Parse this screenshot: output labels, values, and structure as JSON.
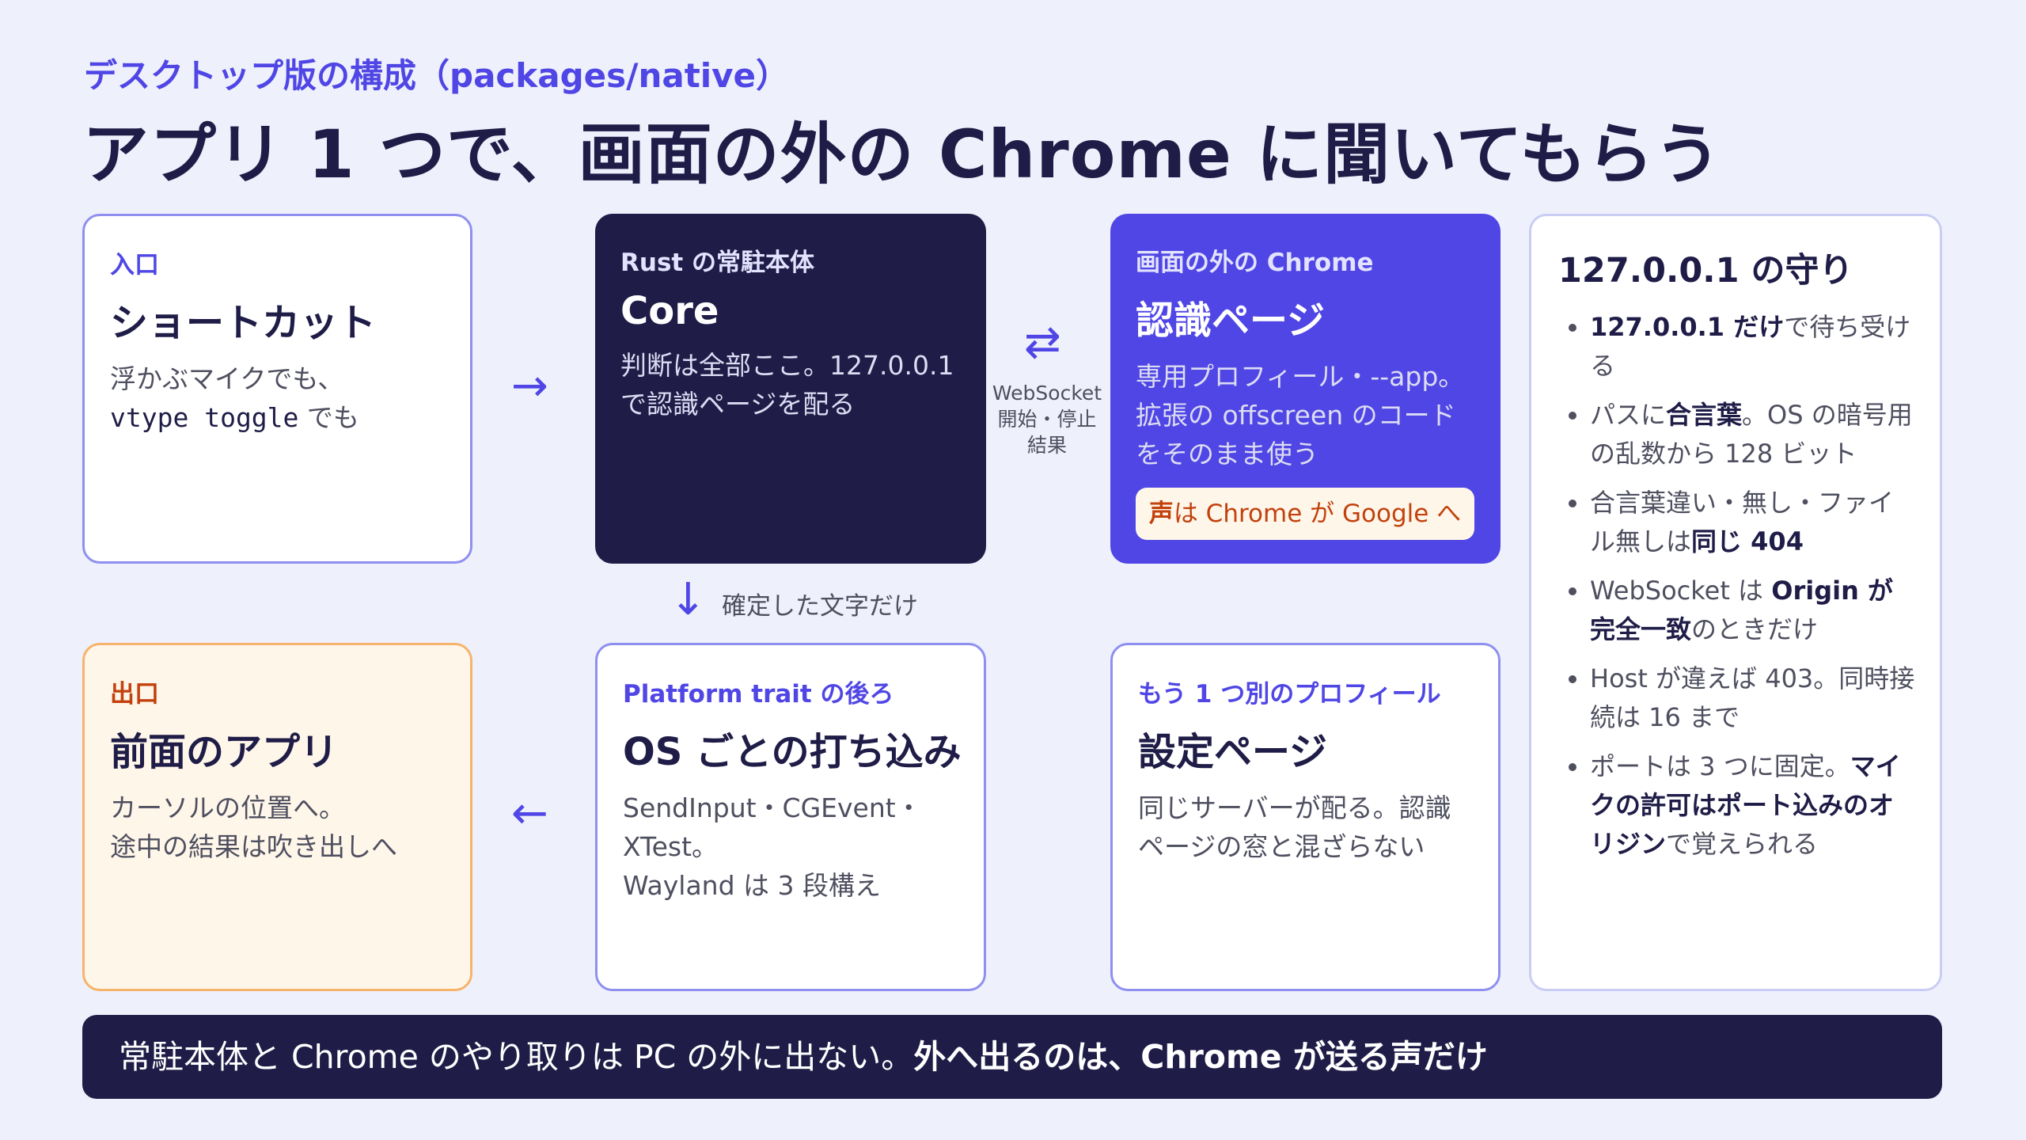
{
  "header": {
    "eyebrow": "デスクトップ版の構成（packages/native）",
    "title": "アプリ 1 つで、画面の外の Chrome に聞いてもらう"
  },
  "boxes": {
    "entry": {
      "kicker": "入口",
      "head": "ショートカット",
      "desc_line1": "浮かぶマイクでも、",
      "desc_mono": "vtype toggle",
      "desc_line2_suffix": " でも"
    },
    "core": {
      "kicker": "Rust の常駐本体",
      "head": "Core",
      "desc": "判断は全部ここ。127.0.0.1 で認識ページを配る"
    },
    "recognition": {
      "kicker": "画面の外の Chrome",
      "head": "認識ページ",
      "desc": "専用プロフィール・--app。拡張の offscreen のコードをそのまま使う",
      "pill_bold": "声",
      "pill_rest": "は Chrome が Google へ"
    },
    "exit": {
      "kicker": "出口",
      "head": "前面のアプリ",
      "desc_line1": "カーソルの位置へ。",
      "desc_line2": "途中の結果は吹き出しへ"
    },
    "platform": {
      "kicker": "Platform trait の後ろ",
      "head": "OS ごとの打ち込み",
      "desc_line1": "SendInput・CGEvent・XTest。",
      "desc_line2": "Wayland は 3 段構え"
    },
    "settings": {
      "kicker": "もう 1 つ別のプロフィール",
      "head": "設定ページ",
      "desc": "同じサーバーが配る。認識ページの窓と混ざらない"
    }
  },
  "arrows": {
    "right": "→",
    "left": "←",
    "down": "↓",
    "bidir": "⇄",
    "ws_line1": "WebSocket",
    "ws_line2": "開始・停止",
    "ws_line3": "結果",
    "down_label": "確定した文字だけ"
  },
  "guard": {
    "title": "127.0.0.1 の守り",
    "items": [
      {
        "bold": "127.0.0.1 だけ",
        "text": "で待ち受ける"
      },
      {
        "pre": "パスに",
        "bold": "合言葉",
        "text": "。OS の暗号用の乱数から 128 ビット"
      },
      {
        "pre": "合言葉違い・無し・ファイル無しは",
        "bold": "同じ 404",
        "text": ""
      },
      {
        "pre": "WebSocket は ",
        "bold": "Origin が完全一致",
        "text": "のときだけ"
      },
      {
        "pre": "Host が違えば 403。同時接続は 16 まで",
        "bold": "",
        "text": ""
      },
      {
        "pre": "ポートは 3 つに固定。",
        "bold": "マイクの許可はポート込みのオリジン",
        "text": "で覚えられる"
      }
    ]
  },
  "footer": {
    "plain": "常駐本体と Chrome のやり取りは PC の外に出ない。",
    "bold": "外へ出るのは、Chrome が送る声だけ"
  },
  "colors": {
    "background": "#eef1fc",
    "navy": "#1f1d47",
    "accent": "#4f46e5",
    "orange": "#c2410c",
    "orange_border": "#f7b36a"
  }
}
